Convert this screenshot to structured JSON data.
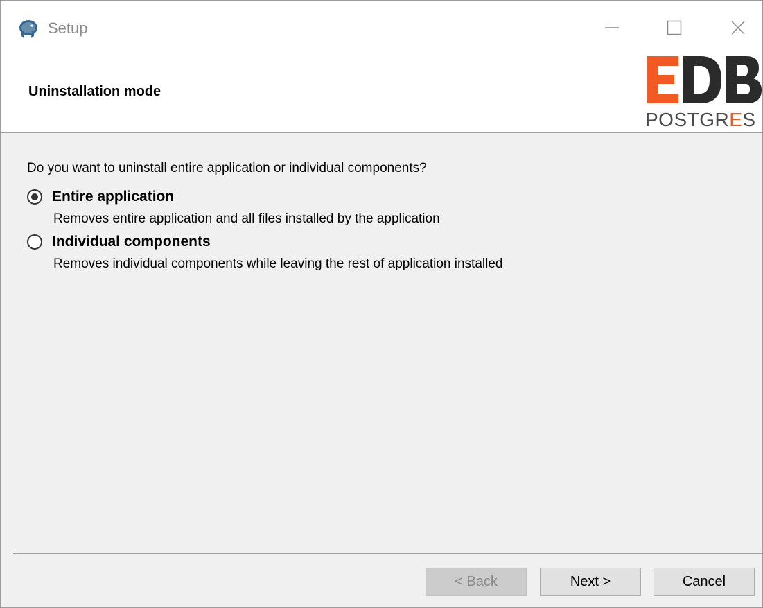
{
  "window": {
    "title": "Setup",
    "controls": {
      "minimize": "minimize-icon",
      "maximize": "maximize-icon",
      "close": "close-icon"
    }
  },
  "header": {
    "title": "Uninstallation mode",
    "logo": {
      "brand": "EDB",
      "sub": "POSTGRES"
    }
  },
  "content": {
    "question": "Do you want to uninstall entire application or individual components?",
    "options": [
      {
        "label": "Entire application",
        "description": "Removes entire application and all files installed by the application",
        "selected": true
      },
      {
        "label": "Individual components",
        "description": "Removes individual components while leaving the rest of application installed",
        "selected": false
      }
    ]
  },
  "buttons": {
    "back": "< Back",
    "next": "Next >",
    "cancel": "Cancel"
  },
  "colors": {
    "logo_orange": "#f15a22",
    "logo_dark": "#2b2b2b",
    "logo_accent": "#f15a22",
    "window_bg": "#f0f0f0"
  }
}
